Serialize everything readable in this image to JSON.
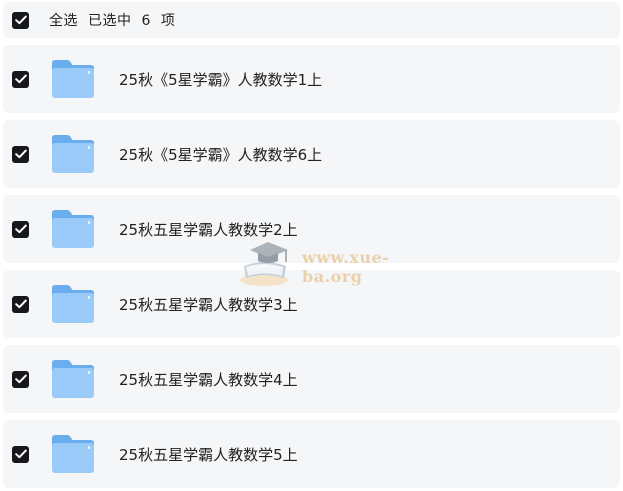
{
  "header": {
    "select_all_label": "全选",
    "selected_prefix": "已选中",
    "selected_count": "6",
    "selected_suffix": "项"
  },
  "folders": [
    {
      "name": "25秋《5星学霸》人教数学1上",
      "checked": true
    },
    {
      "name": "25秋《5星学霸》人教数学6上",
      "checked": true
    },
    {
      "name": "25秋五星学霸人教数学2上",
      "checked": true
    },
    {
      "name": "25秋五星学霸人教数学3上",
      "checked": true
    },
    {
      "name": "25秋五星学霸人教数学4上",
      "checked": true
    },
    {
      "name": "25秋五星学霸人教数学5上",
      "checked": true
    }
  ],
  "watermark": {
    "text": "www.xue-ba.org"
  },
  "icons": {
    "checkbox": "checkmark-icon",
    "folder": "folder-icon"
  },
  "colors": {
    "row_background": "#f5f6f8",
    "checkbox_fill": "#16181c",
    "folder_blue": "#8ec4f7"
  }
}
